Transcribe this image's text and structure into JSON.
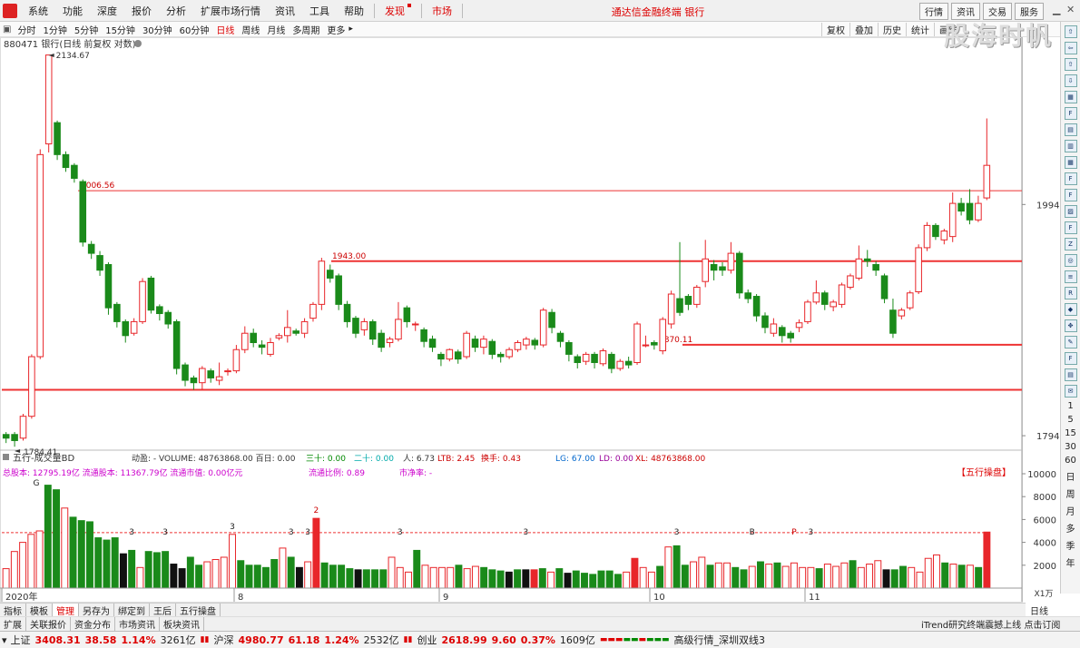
{
  "menu": [
    "系统",
    "功能",
    "深度",
    "报价",
    "分析",
    "扩展市场行情",
    "资讯",
    "工具",
    "帮助"
  ],
  "menu_red": [
    "发现",
    "市场"
  ],
  "app_title": "通达信金融终端  银行",
  "top_right": [
    "行情",
    "资讯",
    "交易",
    "服务"
  ],
  "periods": [
    "分时",
    "1分钟",
    "5分钟",
    "15分钟",
    "30分钟",
    "60分钟",
    "日线",
    "周线",
    "月线",
    "多周期",
    "更多"
  ],
  "active_period": "日线",
  "tools": [
    "复权",
    "叠加",
    "历史",
    "统计",
    "画线"
  ],
  "watermark": "股海时帆",
  "right_letters": [
    "1",
    "5",
    "15",
    "30",
    "60",
    "日",
    "周",
    "月",
    "多",
    "季",
    "年"
  ],
  "stock_line": "880471 银行(日线 前复权 对数)",
  "volume_indicator": {
    "name": "五行-成交量BD",
    "fields": "动盈: - VOLUME: 48763868.00 百日: 0.00",
    "v_sanshi": "三十: 0.00",
    "v_ershi": "二十: 0.00",
    "v_ren": "人: 6.73",
    "v_ltb": "LTB: 2.45",
    "v_huan": "换手: 0.43",
    "v_lg": "LG: 67.00",
    "v_ld": "LD: 0.00",
    "v_xl": "XL: 48763868.00",
    "caps": "总股本:  12795.19亿 流通股本:  11367.79亿 流通市值:  0.00亿元",
    "ratio": "流通比例:  0.89",
    "pb": "市净率:  -",
    "tag": "【五行操盘】"
  },
  "bottom_tabs": [
    "指标",
    "模板",
    "管理",
    "另存为",
    "绑定到",
    "王后",
    "五行操盘"
  ],
  "bottom_tabs2": [
    "扩展",
    "关联报价",
    "资金分布",
    "市场资讯",
    "板块资讯"
  ],
  "active_tab": "管理",
  "scroll_label": "日线",
  "itrend": "iTrend研究终端震撼上线 点击订阅",
  "ticker": {
    "sh_label": "上证",
    "sh_val": "3408.31",
    "sh_chg": "38.58",
    "sh_pct": "1.14%",
    "sh_amt": "3261亿",
    "hs_label": "沪深",
    "hs_val": "4980.77",
    "hs_chg": "61.18",
    "hs_pct": "1.24%",
    "hs_amt": "2532亿",
    "cy_label": "创业",
    "cy_val": "2618.99",
    "cy_chg": "9.60",
    "cy_pct": "0.37%",
    "cy_amt": "1609亿",
    "feed": "高级行情_深圳双线3"
  },
  "chart_data": {
    "type": "candlestick",
    "price_ylim": [
      1784.41,
      2134.67
    ],
    "log_scale": true,
    "y_ticks": [
      1994,
      1794
    ],
    "annotations": {
      "high": "2134.67",
      "low": "1784.41",
      "level1": "2006.56",
      "level2": "1943.00",
      "level3": "1870.11"
    },
    "hlines": [
      2006.56,
      1943.0,
      1870.11,
      1832
    ],
    "x_labels": [
      "2020年",
      "8",
      "9",
      "10",
      "11"
    ],
    "volume_ticks": [
      "10000",
      "8000",
      "6000",
      "4000",
      "2000"
    ],
    "volume_unit": "X1万",
    "volume_ref": 4850,
    "volume_markers": [
      "G",
      "3",
      "3",
      "3",
      "3",
      "3",
      "2",
      "3",
      "3",
      "3",
      "P",
      "B",
      "P",
      "3"
    ],
    "candles": [
      [
        1792,
        1795,
        1788,
        1797,
        0
      ],
      [
        1795,
        1790,
        1785,
        1797,
        0
      ],
      [
        1792,
        1810,
        1790,
        1812,
        1
      ],
      [
        1810,
        1860,
        1808,
        1862,
        1
      ],
      [
        1860,
        2040,
        1858,
        2045,
        1
      ],
      [
        2050,
        2135,
        2042,
        2135,
        1
      ],
      [
        2070,
        2040,
        2035,
        2072,
        0
      ],
      [
        2040,
        2028,
        2024,
        2043,
        0
      ],
      [
        2030,
        2018,
        2014,
        2032,
        0
      ],
      [
        2015,
        1960,
        1956,
        2017,
        0
      ],
      [
        1958,
        1950,
        1945,
        1961,
        0
      ],
      [
        1948,
        1935,
        1930,
        1952,
        0
      ],
      [
        1940,
        1902,
        1896,
        1942,
        0
      ],
      [
        1905,
        1890,
        1885,
        1907,
        0
      ],
      [
        1890,
        1878,
        1872,
        1892,
        0
      ],
      [
        1880,
        1890,
        1878,
        1893,
        1
      ],
      [
        1890,
        1925,
        1888,
        1928,
        1
      ],
      [
        1928,
        1900,
        1897,
        1930,
        0
      ],
      [
        1903,
        1897,
        1891,
        1905,
        0
      ],
      [
        1898,
        1888,
        1884,
        1900,
        0
      ],
      [
        1890,
        1850,
        1845,
        1892,
        0
      ],
      [
        1853,
        1840,
        1835,
        1855,
        0
      ],
      [
        1842,
        1838,
        1832,
        1844,
        0
      ],
      [
        1838,
        1850,
        1832,
        1852,
        1
      ],
      [
        1848,
        1842,
        1838,
        1850,
        0
      ],
      [
        1840,
        1843,
        1836,
        1855,
        1
      ],
      [
        1848,
        1848,
        1844,
        1850,
        1
      ],
      [
        1848,
        1866,
        1846,
        1870,
        1
      ],
      [
        1866,
        1880,
        1863,
        1886,
        1
      ],
      [
        1880,
        1872,
        1868,
        1884,
        0
      ],
      [
        1870,
        1868,
        1862,
        1874,
        0
      ],
      [
        1862,
        1872,
        1860,
        1876,
        1
      ],
      [
        1876,
        1878,
        1874,
        1880,
        1
      ],
      [
        1878,
        1885,
        1872,
        1900,
        1
      ],
      [
        1882,
        1880,
        1878,
        1884,
        0
      ],
      [
        1880,
        1890,
        1876,
        1893,
        1
      ],
      [
        1893,
        1905,
        1890,
        1907,
        1
      ],
      [
        1905,
        1943,
        1900,
        1946,
        1
      ],
      [
        1935,
        1928,
        1924,
        1940,
        0
      ],
      [
        1930,
        1905,
        1900,
        1932,
        0
      ],
      [
        1905,
        1890,
        1885,
        1908,
        0
      ],
      [
        1893,
        1880,
        1876,
        1895,
        0
      ],
      [
        1883,
        1890,
        1878,
        1893,
        1
      ],
      [
        1890,
        1875,
        1870,
        1892,
        0
      ],
      [
        1880,
        1868,
        1864,
        1883,
        0
      ],
      [
        1872,
        1875,
        1868,
        1877,
        1
      ],
      [
        1875,
        1892,
        1873,
        1907,
        1
      ],
      [
        1902,
        1890,
        1885,
        1904,
        0
      ],
      [
        1888,
        1888,
        1882,
        1890,
        1
      ],
      [
        1883,
        1873,
        1868,
        1885,
        0
      ],
      [
        1875,
        1868,
        1864,
        1878,
        0
      ],
      [
        1862,
        1858,
        1852,
        1864,
        0
      ],
      [
        1858,
        1866,
        1856,
        1867,
        1
      ],
      [
        1864,
        1858,
        1854,
        1866,
        0
      ],
      [
        1860,
        1880,
        1858,
        1882,
        1
      ],
      [
        1875,
        1868,
        1864,
        1878,
        0
      ],
      [
        1868,
        1875,
        1862,
        1878,
        1
      ],
      [
        1873,
        1862,
        1858,
        1875,
        0
      ],
      [
        1862,
        1860,
        1855,
        1864,
        0
      ],
      [
        1860,
        1866,
        1858,
        1868,
        1
      ],
      [
        1866,
        1872,
        1864,
        1874,
        1
      ],
      [
        1870,
        1875,
        1866,
        1877,
        1
      ],
      [
        1874,
        1870,
        1866,
        1876,
        0
      ],
      [
        1870,
        1900,
        1868,
        1902,
        1
      ],
      [
        1898,
        1885,
        1880,
        1901,
        0
      ],
      [
        1880,
        1873,
        1868,
        1882,
        0
      ],
      [
        1872,
        1862,
        1856,
        1874,
        0
      ],
      [
        1860,
        1855,
        1850,
        1862,
        0
      ],
      [
        1856,
        1862,
        1853,
        1864,
        1
      ],
      [
        1862,
        1855,
        1850,
        1864,
        0
      ],
      [
        1854,
        1865,
        1852,
        1867,
        1
      ],
      [
        1862,
        1850,
        1846,
        1864,
        0
      ],
      [
        1850,
        1856,
        1848,
        1858,
        1
      ],
      [
        1853,
        1856,
        1850,
        1860,
        0
      ],
      [
        1855,
        1888,
        1853,
        1890,
        1
      ],
      [
        1870,
        1870,
        1868,
        1878,
        1
      ],
      [
        1872,
        1870,
        1866,
        1874,
        0
      ],
      [
        1865,
        1892,
        1862,
        1894,
        1
      ],
      [
        1888,
        1914,
        1884,
        1917,
        1
      ],
      [
        1898,
        1910,
        1895,
        1960,
        0
      ],
      [
        1912,
        1905,
        1900,
        1914,
        0
      ],
      [
        1905,
        1920,
        1902,
        1922,
        1
      ],
      [
        1925,
        1945,
        1920,
        1962,
        1
      ],
      [
        1940,
        1935,
        1926,
        1944,
        0
      ],
      [
        1938,
        1935,
        1930,
        1942,
        0
      ],
      [
        1935,
        1950,
        1932,
        1960,
        1
      ],
      [
        1950,
        1915,
        1910,
        1952,
        0
      ],
      [
        1915,
        1910,
        1906,
        1918,
        0
      ],
      [
        1912,
        1895,
        1890,
        1914,
        0
      ],
      [
        1895,
        1885,
        1880,
        1898,
        0
      ],
      [
        1880,
        1888,
        1877,
        1893,
        1
      ],
      [
        1885,
        1878,
        1872,
        1887,
        0
      ],
      [
        1880,
        1876,
        1872,
        1882,
        0
      ],
      [
        1885,
        1889,
        1881,
        1892,
        1
      ],
      [
        1890,
        1907,
        1888,
        1909,
        1
      ],
      [
        1907,
        1915,
        1905,
        1926,
        1
      ],
      [
        1915,
        1905,
        1900,
        1917,
        0
      ],
      [
        1903,
        1907,
        1899,
        1909,
        1
      ],
      [
        1905,
        1922,
        1902,
        1924,
        1
      ],
      [
        1920,
        1930,
        1918,
        1932,
        1
      ],
      [
        1928,
        1945,
        1926,
        1957,
        1
      ],
      [
        1945,
        1943,
        1938,
        1953,
        0
      ],
      [
        1940,
        1935,
        1930,
        1943,
        0
      ],
      [
        1930,
        1910,
        1906,
        1932,
        0
      ],
      [
        1900,
        1880,
        1876,
        1910,
        0
      ],
      [
        1895,
        1900,
        1892,
        1902,
        1
      ],
      [
        1902,
        1915,
        1900,
        1917,
        1
      ],
      [
        1916,
        1955,
        1914,
        1958,
        1
      ],
      [
        1955,
        1975,
        1952,
        1978,
        1
      ],
      [
        1975,
        1965,
        1962,
        1977,
        0
      ],
      [
        1962,
        1970,
        1958,
        1972,
        1
      ],
      [
        1965,
        1995,
        1960,
        2005,
        1
      ],
      [
        1995,
        1988,
        1984,
        2000,
        0
      ],
      [
        1995,
        1980,
        1976,
        2008,
        0
      ],
      [
        1980,
        1995,
        1978,
        2002,
        1
      ],
      [
        2000,
        2030,
        1998,
        2074,
        1
      ]
    ],
    "volumes": [
      [
        1700,
        1
      ],
      [
        3200,
        1
      ],
      [
        4000,
        1
      ],
      [
        4700,
        1
      ],
      [
        5000,
        1
      ],
      [
        9000,
        0
      ],
      [
        8600,
        0
      ],
      [
        7000,
        1
      ],
      [
        6200,
        0
      ],
      [
        5900,
        0
      ],
      [
        5800,
        0
      ],
      [
        4400,
        0
      ],
      [
        4200,
        0
      ],
      [
        4400,
        0
      ],
      [
        3000,
        2
      ],
      [
        3300,
        0
      ],
      [
        1800,
        1
      ],
      [
        3200,
        0
      ],
      [
        3100,
        0
      ],
      [
        3200,
        0
      ],
      [
        2100,
        2
      ],
      [
        1700,
        2
      ],
      [
        2700,
        0
      ],
      [
        2000,
        0
      ],
      [
        2300,
        1
      ],
      [
        2500,
        1
      ],
      [
        2700,
        1
      ],
      [
        4700,
        1
      ],
      [
        2400,
        0
      ],
      [
        2000,
        0
      ],
      [
        2000,
        0
      ],
      [
        1800,
        0
      ],
      [
        2500,
        0
      ],
      [
        3500,
        1
      ],
      [
        2700,
        0
      ],
      [
        1800,
        2
      ],
      [
        2300,
        1
      ],
      [
        6100,
        3
      ],
      [
        2200,
        0
      ],
      [
        2000,
        0
      ],
      [
        2000,
        0
      ],
      [
        1700,
        0
      ],
      [
        1600,
        2
      ],
      [
        1600,
        0
      ],
      [
        1600,
        0
      ],
      [
        1600,
        0
      ],
      [
        2700,
        1
      ],
      [
        1800,
        1
      ],
      [
        1400,
        1
      ],
      [
        3300,
        0
      ],
      [
        2000,
        1
      ],
      [
        1800,
        1
      ],
      [
        1800,
        1
      ],
      [
        1800,
        1
      ],
      [
        2000,
        0
      ],
      [
        1700,
        1
      ],
      [
        1900,
        1
      ],
      [
        1800,
        0
      ],
      [
        1600,
        0
      ],
      [
        1500,
        0
      ],
      [
        1400,
        2
      ],
      [
        1600,
        0
      ],
      [
        1600,
        2
      ],
      [
        1600,
        3
      ],
      [
        1700,
        0
      ],
      [
        1400,
        1
      ],
      [
        1700,
        0
      ],
      [
        1300,
        2
      ],
      [
        1500,
        0
      ],
      [
        1300,
        0
      ],
      [
        1200,
        0
      ],
      [
        1500,
        0
      ],
      [
        1500,
        0
      ],
      [
        1200,
        0
      ],
      [
        1400,
        1
      ],
      [
        2600,
        3
      ],
      [
        1800,
        1
      ],
      [
        1400,
        1
      ],
      [
        1900,
        0
      ],
      [
        3600,
        1
      ],
      [
        3700,
        0
      ],
      [
        2000,
        0
      ],
      [
        2300,
        1
      ],
      [
        2700,
        1
      ],
      [
        2000,
        0
      ],
      [
        2200,
        1
      ],
      [
        2200,
        1
      ],
      [
        1800,
        0
      ],
      [
        1600,
        0
      ],
      [
        1900,
        1
      ],
      [
        2300,
        0
      ],
      [
        2100,
        1
      ],
      [
        2200,
        0
      ],
      [
        1900,
        1
      ],
      [
        2200,
        1
      ],
      [
        1800,
        1
      ],
      [
        1800,
        1
      ],
      [
        1700,
        0
      ],
      [
        2100,
        1
      ],
      [
        1900,
        1
      ],
      [
        2200,
        1
      ],
      [
        2400,
        0
      ],
      [
        1800,
        1
      ],
      [
        2100,
        1
      ],
      [
        2400,
        1
      ],
      [
        1600,
        2
      ],
      [
        1600,
        0
      ],
      [
        1900,
        0
      ],
      [
        1800,
        1
      ],
      [
        1400,
        1
      ],
      [
        2600,
        1
      ],
      [
        2900,
        1
      ],
      [
        2200,
        0
      ],
      [
        2100,
        1
      ],
      [
        2000,
        0
      ],
      [
        2000,
        1
      ],
      [
        1800,
        0
      ],
      [
        4900,
        3
      ]
    ]
  }
}
